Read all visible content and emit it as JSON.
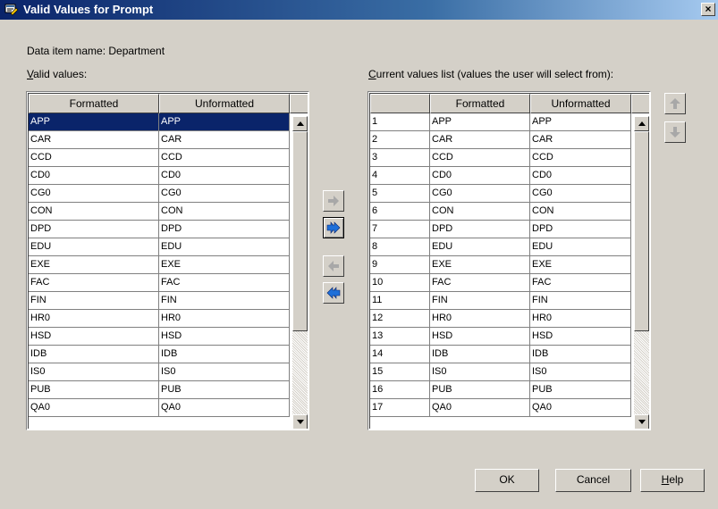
{
  "window": {
    "title": "Valid Values for Prompt",
    "close_label": "×"
  },
  "data_item": "Data item name: Department",
  "valid_values": {
    "label_mnemonic": "V",
    "label_rest": "alid values:",
    "columns": [
      "Formatted",
      "Unformatted"
    ],
    "rows": [
      [
        "APP",
        "APP"
      ],
      [
        "CAR",
        "CAR"
      ],
      [
        "CCD",
        "CCD"
      ],
      [
        "CD0",
        "CD0"
      ],
      [
        "CG0",
        "CG0"
      ],
      [
        "CON",
        "CON"
      ],
      [
        "DPD",
        "DPD"
      ],
      [
        "EDU",
        "EDU"
      ],
      [
        "EXE",
        "EXE"
      ],
      [
        "FAC",
        "FAC"
      ],
      [
        "FIN",
        "FIN"
      ],
      [
        "HR0",
        "HR0"
      ],
      [
        "HSD",
        "HSD"
      ],
      [
        "IDB",
        "IDB"
      ],
      [
        "IS0",
        "IS0"
      ],
      [
        "PUB",
        "PUB"
      ],
      [
        "QA0",
        "QA0"
      ]
    ],
    "selected_index": 0
  },
  "current_values": {
    "label_mnemonic": "C",
    "label_rest": "urrent values list (values the user will select from):",
    "columns": [
      "",
      "Formatted",
      "Unformatted"
    ],
    "rows": [
      [
        "1",
        "APP",
        "APP"
      ],
      [
        "2",
        "CAR",
        "CAR"
      ],
      [
        "3",
        "CCD",
        "CCD"
      ],
      [
        "4",
        "CD0",
        "CD0"
      ],
      [
        "5",
        "CG0",
        "CG0"
      ],
      [
        "6",
        "CON",
        "CON"
      ],
      [
        "7",
        "DPD",
        "DPD"
      ],
      [
        "8",
        "EDU",
        "EDU"
      ],
      [
        "9",
        "EXE",
        "EXE"
      ],
      [
        "10",
        "FAC",
        "FAC"
      ],
      [
        "11",
        "FIN",
        "FIN"
      ],
      [
        "12",
        "HR0",
        "HR0"
      ],
      [
        "13",
        "HSD",
        "HSD"
      ],
      [
        "14",
        "IDB",
        "IDB"
      ],
      [
        "15",
        "IS0",
        "IS0"
      ],
      [
        "16",
        "PUB",
        "PUB"
      ],
      [
        "17",
        "QA0",
        "QA0"
      ]
    ]
  },
  "transfer_buttons": [
    {
      "icon": "arrow-right-icon",
      "active": false
    },
    {
      "icon": "double-arrow-right-icon",
      "active": true
    },
    {
      "icon": "arrow-left-icon",
      "active": false
    },
    {
      "icon": "double-arrow-left-icon",
      "active": false
    }
  ],
  "order_buttons": [
    {
      "icon": "arrow-up-icon"
    },
    {
      "icon": "arrow-down-icon"
    }
  ],
  "buttons": {
    "ok": "OK",
    "cancel": "Cancel",
    "help_mnemonic": "H",
    "help_rest": "elp"
  },
  "colors": {
    "title_gradient_start": "#0a246a",
    "selection": "#0a246a",
    "face": "#d4d0c8",
    "arrow_gray": "#a8a8a8",
    "arrow_blue": "#1e6fd9"
  }
}
